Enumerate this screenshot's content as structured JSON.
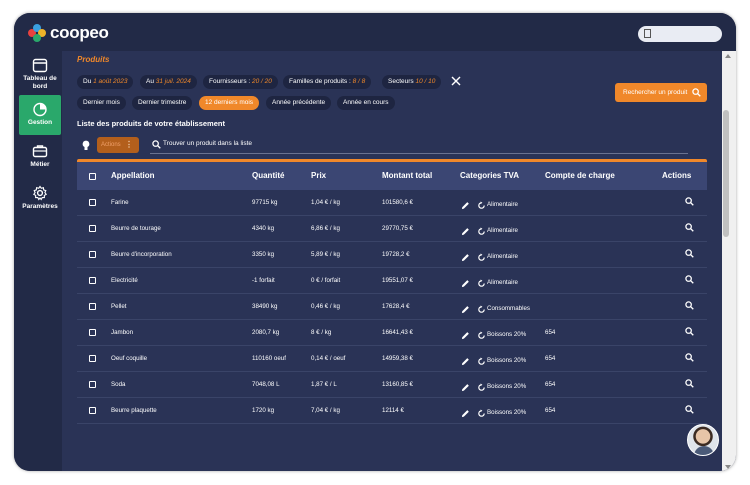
{
  "app": {
    "logo_text": "coopeo",
    "logo_colors": [
      "#e8423f",
      "#2aa86b",
      "#3aa0e0",
      "#f0b429"
    ]
  },
  "sidebar": {
    "items": [
      {
        "label": "Tableau de bord",
        "icon": "calendar-icon",
        "active": false
      },
      {
        "label": "Gestion",
        "icon": "pie-chart-icon",
        "active": true
      },
      {
        "label": "Métier",
        "icon": "briefcase-icon",
        "active": false
      },
      {
        "label": "Paramètres",
        "icon": "gear-icon",
        "active": false
      }
    ]
  },
  "page": {
    "section_title": "Produits",
    "list_title": "Liste des produits de votre établissement"
  },
  "filters": {
    "du_label": "Du",
    "du_value": "1 août 2023",
    "au_label": "Au",
    "au_value": "31 juil. 2024",
    "fournisseurs_label": "Fournisseurs :",
    "fournisseurs_value": "20 / 20",
    "familles_label": "Familles de produits :",
    "familles_value": "8 / 8",
    "secteurs_label": "Secteurs",
    "secteurs_value": "10 / 10"
  },
  "periods": [
    "Dernier mois",
    "Dernier trimestre",
    "12 derniers mois",
    "Année précédente",
    "Année en cours"
  ],
  "active_period": "12 derniers mois",
  "toolbar": {
    "search_product_button": "Rechercher un produit",
    "actions_button": "Actions",
    "find_placeholder": "Trouver un produit dans la liste"
  },
  "table": {
    "headers": {
      "appellation": "Appellation",
      "quantite": "Quantité",
      "prix": "Prix",
      "montant": "Montant total",
      "tva": "Categories TVA",
      "compte": "Compte de charge",
      "actions": "Actions"
    },
    "rows": [
      {
        "appellation": "Farine",
        "quantite": "97715 kg",
        "prix": "1,04 € / kg",
        "montant": "101580,6 €",
        "tva": "Alimentaire",
        "compte": ""
      },
      {
        "appellation": "Beurre de tourage",
        "quantite": "4340 kg",
        "prix": "6,86 € / kg",
        "montant": "29770,75 €",
        "tva": "Alimentaire",
        "compte": ""
      },
      {
        "appellation": "Beurre d'incorporation",
        "quantite": "3350 kg",
        "prix": "5,89 € / kg",
        "montant": "19728,2 €",
        "tva": "Alimentaire",
        "compte": ""
      },
      {
        "appellation": "Electricité",
        "quantite": "-1 forfait",
        "prix": "0 € / forfait",
        "montant": "19551,07 €",
        "tva": "Alimentaire",
        "compte": ""
      },
      {
        "appellation": "Pellet",
        "quantite": "38490 kg",
        "prix": "0,46 € / kg",
        "montant": "17628,4 €",
        "tva": "Consommables",
        "compte": ""
      },
      {
        "appellation": "Jambon",
        "quantite": "2080,7 kg",
        "prix": "8 € / kg",
        "montant": "16641,43 €",
        "tva": "Boissons 20%",
        "compte": "654"
      },
      {
        "appellation": "Oeuf coquille",
        "quantite": "110160 oeuf",
        "prix": "0,14 € / oeuf",
        "montant": "14959,38 €",
        "tva": "Boissons 20%",
        "compte": "654"
      },
      {
        "appellation": "Soda",
        "quantite": "7048,08 L",
        "prix": "1,87 € / L",
        "montant": "13160,85 €",
        "tva": "Boissons 20%",
        "compte": "654"
      },
      {
        "appellation": "Beurre plaquette",
        "quantite": "1720 kg",
        "prix": "7,04 € / kg",
        "montant": "12114 €",
        "tva": "Boissons 20%",
        "compte": "654"
      }
    ]
  },
  "colors": {
    "accent": "#f0882a",
    "active_nav": "#2aa86b",
    "panel": "#2a3356",
    "header": "#3b4673"
  }
}
